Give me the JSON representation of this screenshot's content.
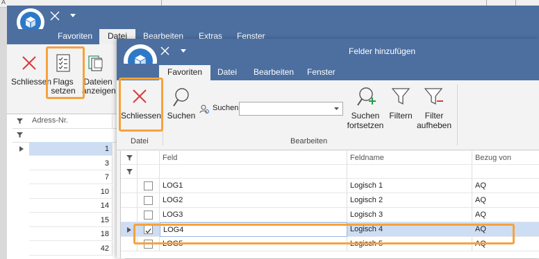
{
  "bg_window": {
    "top_strip_text": "A",
    "tabs": [
      "Favoriten",
      "Datei",
      "Bearbeiten",
      "Extras",
      "Fenster"
    ],
    "active_tab": "Datei",
    "ribbon": {
      "close_label": "Schliessen",
      "flags_label_1": "Flags",
      "flags_label_2": "setzen",
      "files_label_1": "Dateien",
      "files_label_2": "anzeigen"
    },
    "grid": {
      "column_header": "Adress-Nr.",
      "column_header_2": "K",
      "rows": [
        "1",
        "3",
        "7",
        "10",
        "14",
        "15",
        "18",
        "42"
      ]
    }
  },
  "front_window": {
    "title": "Felder hinzufügen",
    "tabs": [
      "Favoriten",
      "Datei",
      "Bearbeiten",
      "Fenster"
    ],
    "active_tab": "Favoriten",
    "ribbon": {
      "close_label": "Schliessen",
      "search_label": "Suchen",
      "search_field_label": "Suchen",
      "search_value": "",
      "continue_search_1": "Suchen",
      "continue_search_2": "fortsetzen",
      "filter_label": "Filtern",
      "remove_filter_1": "Filter",
      "remove_filter_2": "aufheben",
      "group_file": "Datei",
      "group_edit": "Bearbeiten"
    },
    "grid": {
      "columns": [
        "Feld",
        "Feldname",
        "Bezug von"
      ],
      "rows": [
        {
          "feld": "LOG1",
          "feldname": "Logisch 1",
          "bezug": "AQ",
          "checked": false
        },
        {
          "feld": "LOG2",
          "feldname": "Logisch 2",
          "bezug": "AQ",
          "checked": false
        },
        {
          "feld": "LOG3",
          "feldname": "Logisch 3",
          "bezug": "AQ",
          "checked": false
        },
        {
          "feld": "LOG4",
          "feldname": "Logisch 4",
          "bezug": "AQ",
          "checked": true
        },
        {
          "feld": "LOG5",
          "feldname": "Logisch 5",
          "bezug": "AQ",
          "checked": false
        }
      ],
      "selected_row": 3
    }
  },
  "colors": {
    "titlebar": "#4c6fa0",
    "highlight": "#f6a23c",
    "selection": "#cdddf3",
    "close_red": "#d9383a"
  },
  "icons": [
    "app-logo-icon",
    "close-x-icon",
    "dropdown-arrow-icon",
    "flags-icon",
    "files-icon",
    "search-icon",
    "search-person-icon",
    "search-plus-icon",
    "filter-icon",
    "filter-remove-icon",
    "filter-row-icon",
    "row-pointer-icon"
  ]
}
